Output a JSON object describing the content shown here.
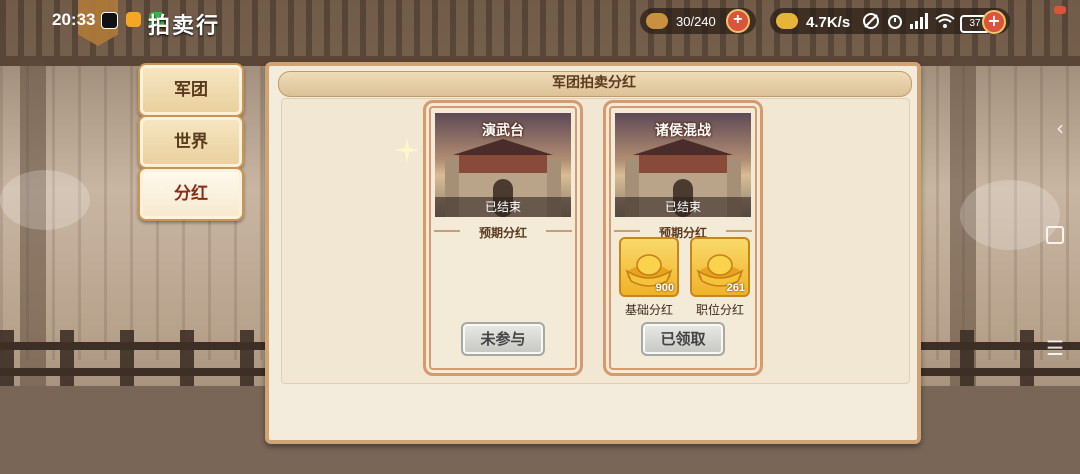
{
  "status_bar": {
    "time": "20:33",
    "network_speed": "4.7K/s",
    "battery": "37"
  },
  "header": {
    "title": "拍卖行",
    "resource_1": {
      "value": "30/240",
      "icon": "food-icon"
    },
    "resource_2": {
      "icon": "gold-ingot-icon"
    }
  },
  "tabs": [
    {
      "label": "军团",
      "active": false
    },
    {
      "label": "世界",
      "active": false
    },
    {
      "label": "分红",
      "active": true
    }
  ],
  "panel": {
    "title": "军团拍卖分红"
  },
  "cards": [
    {
      "name": "演武台",
      "status": "已结束",
      "section_label": "预期分红",
      "rewards": [],
      "button_label": "未参与"
    },
    {
      "name": "诸侯混战",
      "status": "已结束",
      "section_label": "预期分红",
      "rewards": [
        {
          "count": "900",
          "label": "基础分红",
          "icon": "gold-ingot-icon"
        },
        {
          "count": "261",
          "label": "职位分红",
          "icon": "gold-ingot-icon"
        }
      ],
      "button_label": "已领取"
    }
  ],
  "colors": {
    "panel_border": "#d0a373",
    "card_border": "#d59a6e",
    "reward_gold": "#f0b22a",
    "tab_text": "#5a3a1e"
  }
}
